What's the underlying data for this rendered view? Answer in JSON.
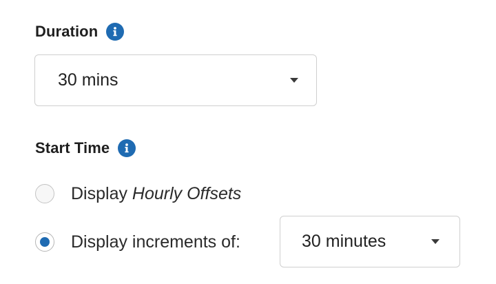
{
  "duration": {
    "label": "Duration",
    "info_icon": "info-icon",
    "selected": "30 mins"
  },
  "start_time": {
    "label": "Start Time",
    "info_icon": "info-icon",
    "options": [
      {
        "label_prefix": "Display ",
        "label_emphasis": "Hourly Offsets",
        "checked": false
      },
      {
        "label": "Display increments of:",
        "checked": true
      }
    ],
    "increment_selected": "30 minutes"
  },
  "colors": {
    "accent": "#1f6bb2",
    "border": "#cfcfcf",
    "text": "#222222"
  }
}
